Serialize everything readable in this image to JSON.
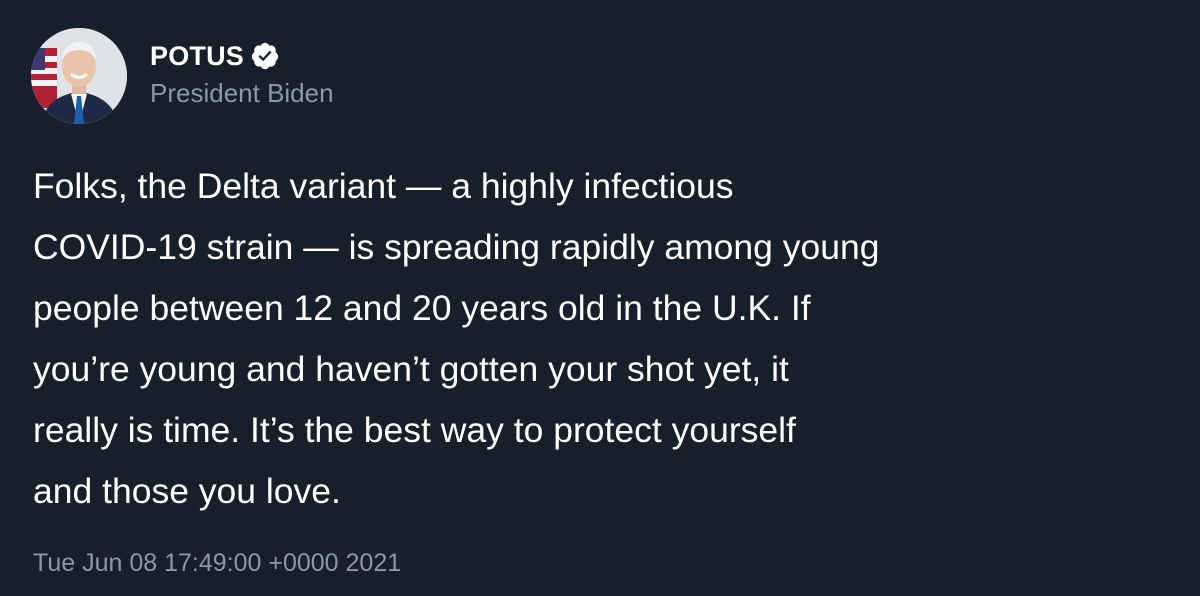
{
  "author": {
    "display_name": "POTUS",
    "handle": "President Biden",
    "verified": true,
    "avatar": "portrait-photo",
    "verified_icon": "verified-badge-icon"
  },
  "tweet": {
    "lines": [
      "Folks, the Delta variant — a highly infectious",
      "COVID-19 strain — is spreading rapidly among young",
      "people between 12 and 20 years old in the U.K. If",
      "you’re young and haven’t gotten your shot yet, it",
      "really is time. It’s the best way to protect yourself",
      "and those you love."
    ],
    "timestamp": "Tue Jun 08 17:49:00 +0000 2021"
  },
  "colors": {
    "background": "#15202b",
    "text_primary": "#ffffff",
    "text_secondary": "#8b98a5"
  }
}
